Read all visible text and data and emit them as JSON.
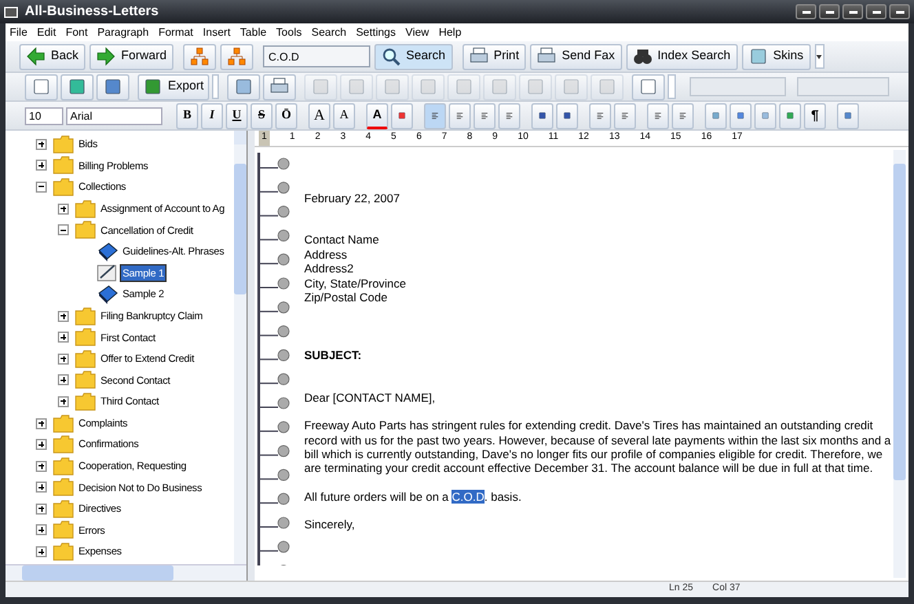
{
  "window": {
    "title": "All-Business-Letters"
  },
  "menu": [
    "File",
    "Edit",
    "Font",
    "Paragraph",
    "Format",
    "Insert",
    "Table",
    "Tools",
    "Search",
    "Settings",
    "View",
    "Help"
  ],
  "toolbar_main": {
    "back": "Back",
    "forward": "Forward",
    "search_value": "C.O.D",
    "search": "Search",
    "print": "Print",
    "send_fax": "Send Fax",
    "index_search": "Index Search",
    "skins": "Skins"
  },
  "toolbar_file": {
    "export": "Export"
  },
  "toolbar_format": {
    "font_size": "10",
    "font": "Arial",
    "style_buttons": [
      {
        "label": "B",
        "kind": "bold"
      },
      {
        "label": "I",
        "kind": "italic"
      },
      {
        "label": "U",
        "kind": "underline"
      },
      {
        "label": "S",
        "kind": "strike"
      },
      {
        "label": "Ō",
        "kind": "overline"
      }
    ],
    "size_buttons": [
      {
        "label": "A",
        "kind": "grow"
      },
      {
        "label": "A",
        "kind": "shrink"
      }
    ],
    "font_color": "A",
    "alignment": [
      {
        "selected": true
      },
      {
        "selected": false
      },
      {
        "selected": false
      },
      {
        "selected": false
      }
    ],
    "pilcrow": "¶"
  },
  "tree": [
    {
      "label": "Bids",
      "kind": "folder",
      "expanded": false,
      "selected": false
    },
    {
      "label": "Billing Problems",
      "kind": "folder",
      "expanded": false,
      "selected": false
    },
    {
      "label": "Collections",
      "kind": "folder",
      "expanded": true,
      "selected": false,
      "children": [
        {
          "label": "Assignment of Account to Ag",
          "kind": "folder",
          "expanded": false,
          "selected": false
        },
        {
          "label": "Cancellation of Credit",
          "kind": "folder",
          "expanded": true,
          "selected": false,
          "children": [
            {
              "label": "Guidelines-Alt. Phrases",
              "kind": "book",
              "selected": false
            },
            {
              "label": "Sample 1",
              "kind": "document",
              "selected": true
            },
            {
              "label": "Sample 2",
              "kind": "book",
              "selected": false
            }
          ]
        },
        {
          "label": "Filing Bankruptcy Claim",
          "kind": "folder",
          "expanded": false,
          "selected": false
        },
        {
          "label": "First Contact",
          "kind": "folder",
          "expanded": false,
          "selected": false
        },
        {
          "label": "Offer to Extend Credit",
          "kind": "folder",
          "expanded": false,
          "selected": false
        },
        {
          "label": "Second Contact",
          "kind": "folder",
          "expanded": false,
          "selected": false
        },
        {
          "label": "Third Contact",
          "kind": "folder",
          "expanded": false,
          "selected": false
        }
      ]
    },
    {
      "label": "Complaints",
      "kind": "folder",
      "expanded": false,
      "selected": false
    },
    {
      "label": "Confirmations",
      "kind": "folder",
      "expanded": false,
      "selected": false
    },
    {
      "label": "Cooperation, Requesting",
      "kind": "folder",
      "expanded": false,
      "selected": false
    },
    {
      "label": "Decision Not to Do Business",
      "kind": "folder",
      "expanded": false,
      "selected": false
    },
    {
      "label": "Directives",
      "kind": "folder",
      "expanded": false,
      "selected": false
    },
    {
      "label": "Errors",
      "kind": "folder",
      "expanded": false,
      "selected": false
    },
    {
      "label": "Expenses",
      "kind": "folder",
      "expanded": false,
      "selected": false
    }
  ],
  "ruler": [
    "1",
    "1",
    "2",
    "3",
    "4",
    "5",
    "6",
    "7",
    "8",
    "9",
    "10",
    "11",
    "12",
    "13",
    "14",
    "15",
    "16",
    "17"
  ],
  "document": [
    {
      "kind": "date",
      "lines": [
        "February 22, 2007"
      ]
    },
    {
      "kind": "address",
      "lines": [
        "Contact Name",
        "Address",
        "Address2",
        "City, State/Province",
        "Zip/Postal Code"
      ]
    },
    {
      "kind": "subject",
      "lines": [
        "SUBJECT:"
      ]
    },
    {
      "kind": "salutation",
      "lines": [
        "Dear [CONTACT NAME],"
      ]
    },
    {
      "kind": "body",
      "lines": [
        "Freeway Auto Parts has stringent rules for extending credit.  Dave's Tires has maintained an outstanding credit record with us for the past two years. However, because of several late payments within the last six months and a bill which is currently outstanding, Dave's no longer fits our profile of companies eligible for credit. Therefore, we are terminating your credit account effective December 31. The account balance will be due in full at that time."
      ]
    },
    {
      "kind": "highlighted",
      "before": "All future orders will be on a ",
      "highlight": "C.O.D",
      "after": ". basis."
    },
    {
      "kind": "closing",
      "lines": [
        "Sincerely,"
      ]
    }
  ],
  "status_bar": [
    "Ln 25",
    "Col 37"
  ]
}
